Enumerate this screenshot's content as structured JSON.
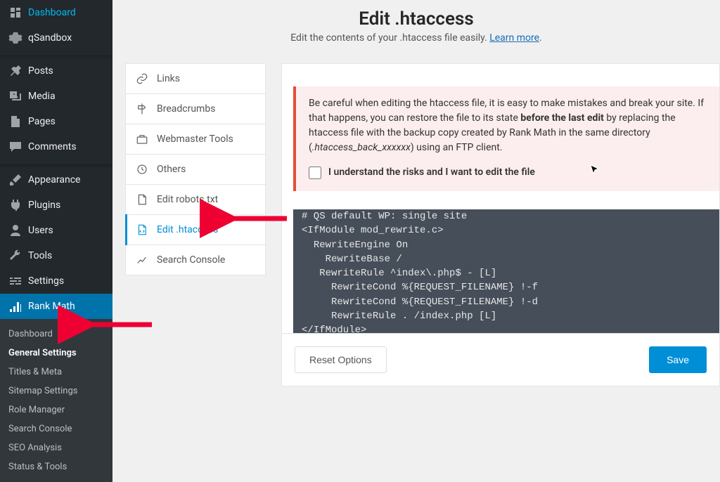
{
  "sidebar": {
    "items": [
      {
        "label": "Dashboard"
      },
      {
        "label": "qSandbox"
      },
      {
        "label": "Posts"
      },
      {
        "label": "Media"
      },
      {
        "label": "Pages"
      },
      {
        "label": "Comments"
      },
      {
        "label": "Appearance"
      },
      {
        "label": "Plugins"
      },
      {
        "label": "Users"
      },
      {
        "label": "Tools"
      },
      {
        "label": "Settings"
      },
      {
        "label": "Rank Math"
      }
    ],
    "submenu": [
      "Dashboard",
      "General Settings",
      "Titles & Meta",
      "Sitemap Settings",
      "Role Manager",
      "Search Console",
      "SEO Analysis",
      "Status & Tools"
    ]
  },
  "header": {
    "title": "Edit .htaccess",
    "desc_prefix": "Edit the contents of your .htaccess file easily. ",
    "learn_more": "Learn more"
  },
  "tabs": [
    {
      "label": "Links"
    },
    {
      "label": "Breadcrumbs"
    },
    {
      "label": "Webmaster Tools"
    },
    {
      "label": "Others"
    },
    {
      "label": "Edit robots.txt"
    },
    {
      "label": "Edit .htaccess"
    },
    {
      "label": "Search Console"
    }
  ],
  "warning": {
    "text_before_bold": "Be careful when editing the htaccess file, it is easy to make mistakes and break your site. If that happens, you can restore the file to its state ",
    "bold": "before the last edit",
    "text_after_bold": " by replacing the htaccess file with the backup copy created by Rank Math in the same directory (",
    "backup_filename": ".htaccess_back_xxxxxx",
    "text_end": ") using an FTP client.",
    "checkbox_label": "I understand the risks and I want to edit the file"
  },
  "code": "# QS default WP: single site\n<IfModule mod_rewrite.c>\n  RewriteEngine On\n    RewriteBase /\n   RewriteRule ^index\\.php$ - [L]\n     RewriteCond %{REQUEST_FILENAME} !-f\n     RewriteCond %{REQUEST_FILENAME} !-d\n     RewriteRule . /index.php [L]\n</IfModule>\n# END WordPress\n#</qs>",
  "buttons": {
    "reset": "Reset Options",
    "save": "Save"
  }
}
